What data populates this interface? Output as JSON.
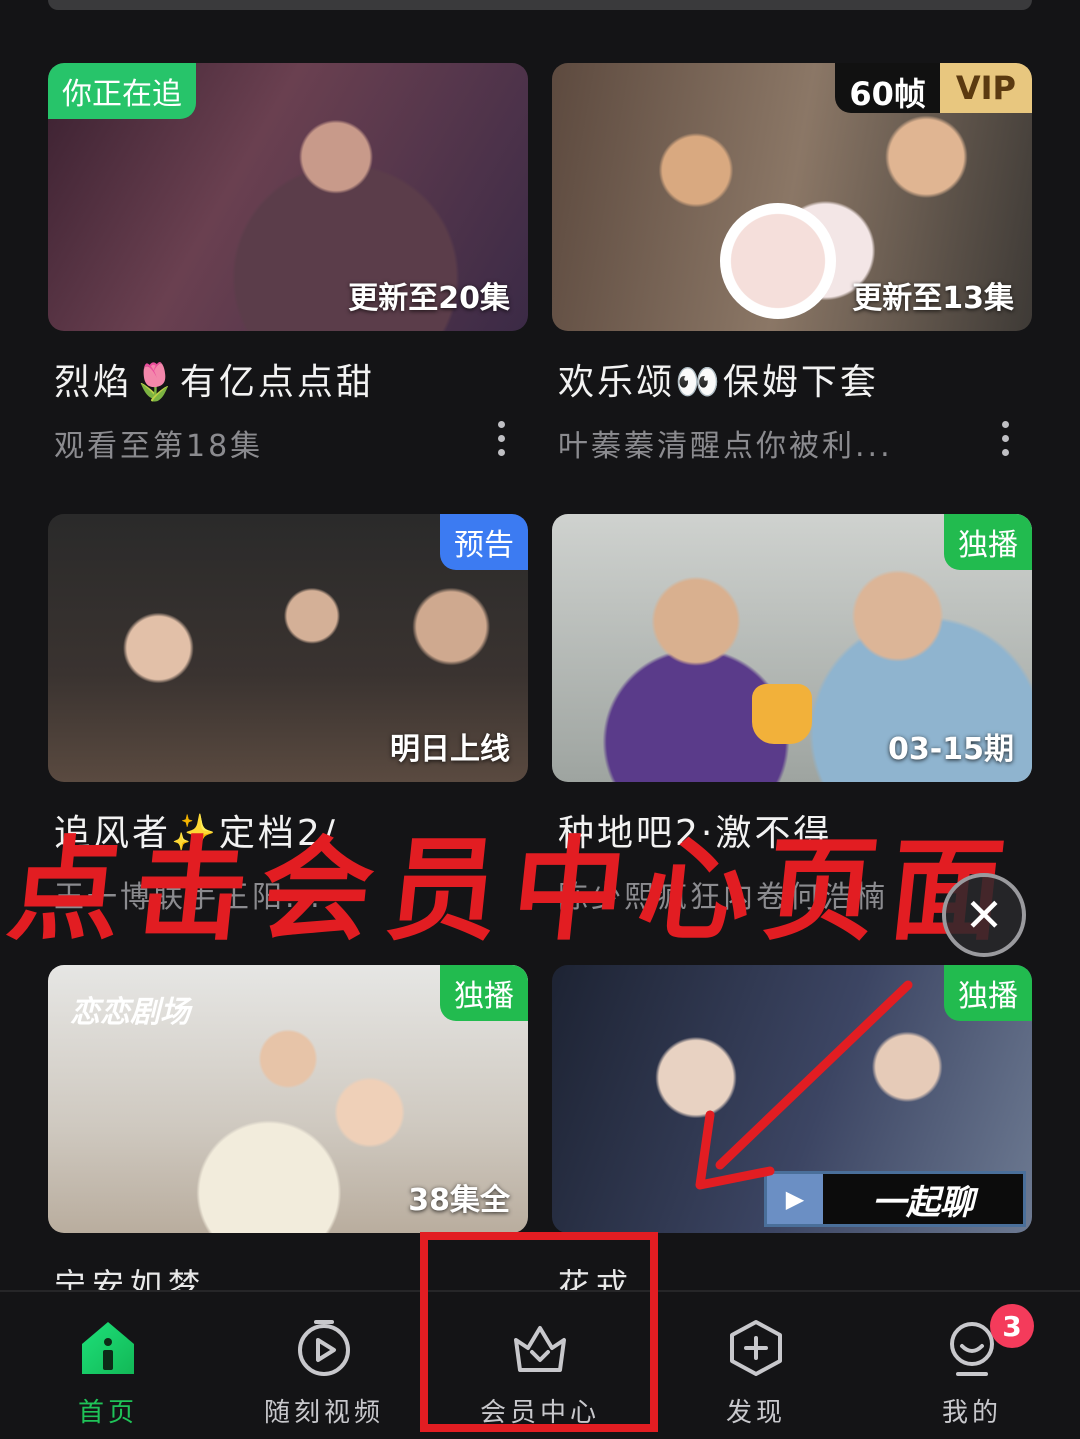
{
  "cards": [
    {
      "badge": "你正在追",
      "overlay": "更新至20集",
      "title": "烈焰🌷有亿点点甜",
      "subtitle": "观看至第18集"
    },
    {
      "badge_fps": "60帧",
      "badge_vip": "VIP",
      "overlay": "更新至13集",
      "title": "欢乐颂👀保姆下套",
      "subtitle": "叶蓁蓁清醒点你被利..."
    },
    {
      "badge": "预告",
      "overlay": "明日上线",
      "title": "追风者✨定档2/",
      "subtitle": "王一博联手王阳..."
    },
    {
      "badge": "独播",
      "overlay": "03-15期",
      "title": "种地吧2·激不得",
      "subtitle": "陈少熙疯狂内卷何浩楠"
    },
    {
      "badge": "独播",
      "logo": "恋恋剧场",
      "overlay": "38集全",
      "title": "宁安如梦",
      "subtitle": ""
    },
    {
      "badge": "独播",
      "banner": "一起聊",
      "title": "花戎",
      "subtitle": ""
    }
  ],
  "annotation": {
    "text": "点击会员中心页面",
    "color": "#e21d22"
  },
  "close_symbol": "✕",
  "nav": [
    {
      "label": "首页",
      "icon": "home-icon",
      "active": true
    },
    {
      "label": "随刻视频",
      "icon": "play-circle-icon",
      "active": false
    },
    {
      "label": "会员中心",
      "icon": "vip-crown-icon",
      "active": false
    },
    {
      "label": "发现",
      "icon": "plus-hexagon-icon",
      "active": false
    },
    {
      "label": "我的",
      "icon": "profile-icon",
      "active": false,
      "badge": "3"
    }
  ],
  "colors": {
    "accent_green": "#1fc358",
    "background": "#141416",
    "badge_red": "#f43b5b"
  }
}
